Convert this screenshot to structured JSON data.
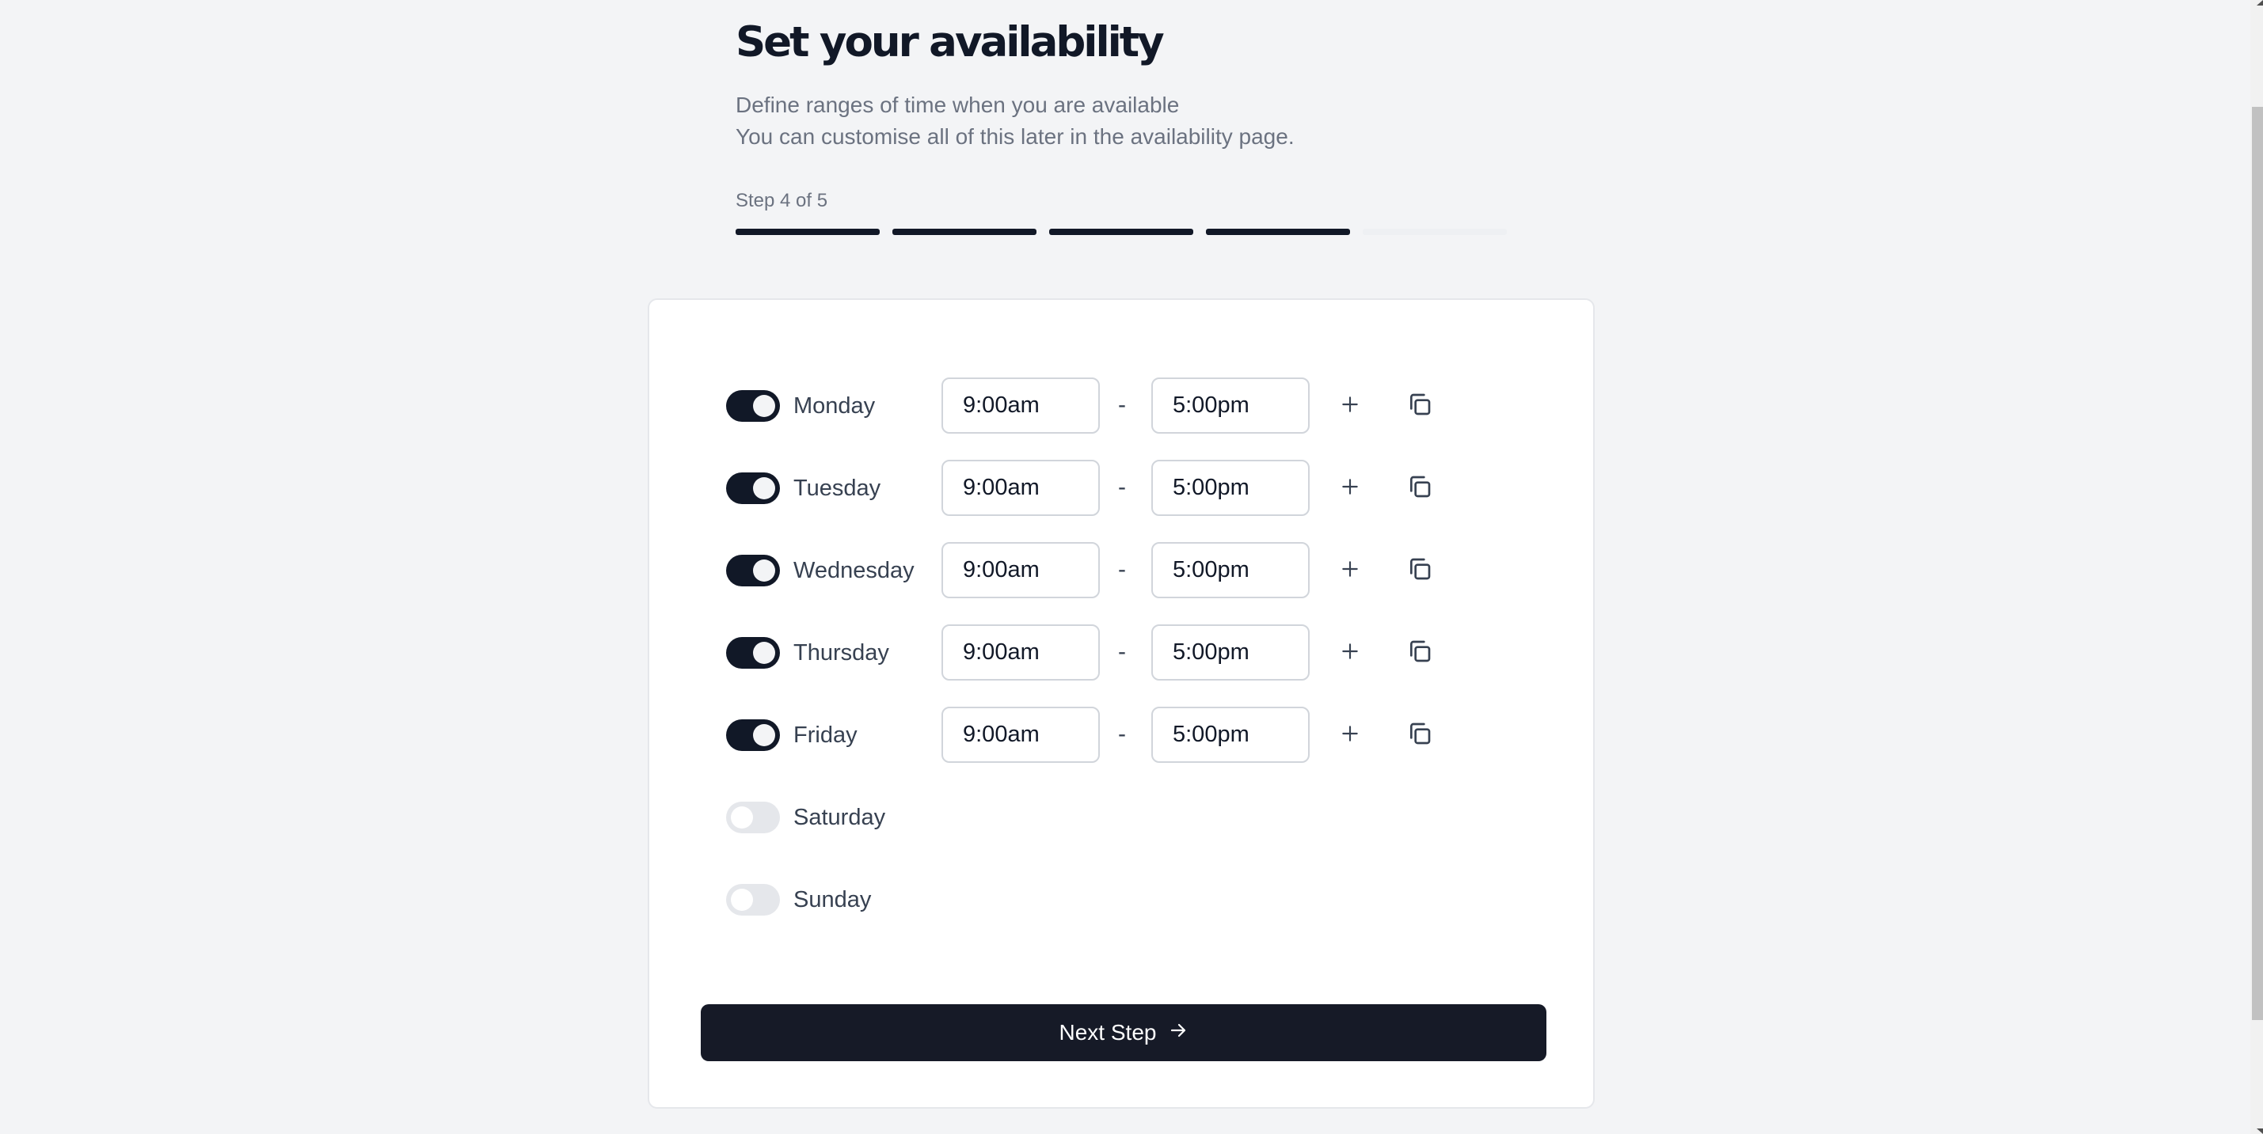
{
  "header": {
    "title": "Set your availability",
    "subtitle_lines": [
      "Define ranges of time when you are available",
      "You can customise all of this later in the availability page."
    ],
    "step_label": "Step 4 of 5",
    "progress": {
      "current_step": 4,
      "total_steps": 5
    }
  },
  "colors": {
    "accent": "#111827",
    "toggle_off": "#e5e7eb",
    "page_bg": "#f3f4f6",
    "input_border": "#d1d5db"
  },
  "schedule": [
    {
      "day": "Monday",
      "enabled": true,
      "start": "9:00am",
      "end": "5:00pm"
    },
    {
      "day": "Tuesday",
      "enabled": true,
      "start": "9:00am",
      "end": "5:00pm"
    },
    {
      "day": "Wednesday",
      "enabled": true,
      "start": "9:00am",
      "end": "5:00pm"
    },
    {
      "day": "Thursday",
      "enabled": true,
      "start": "9:00am",
      "end": "5:00pm"
    },
    {
      "day": "Friday",
      "enabled": true,
      "start": "9:00am",
      "end": "5:00pm"
    },
    {
      "day": "Saturday",
      "enabled": false
    },
    {
      "day": "Sunday",
      "enabled": false
    }
  ],
  "range_separator": "-",
  "icons": {
    "add": "plus-icon",
    "copy": "copy-icon",
    "next": "arrow-right-icon"
  },
  "next_button": {
    "label": "Next Step"
  }
}
